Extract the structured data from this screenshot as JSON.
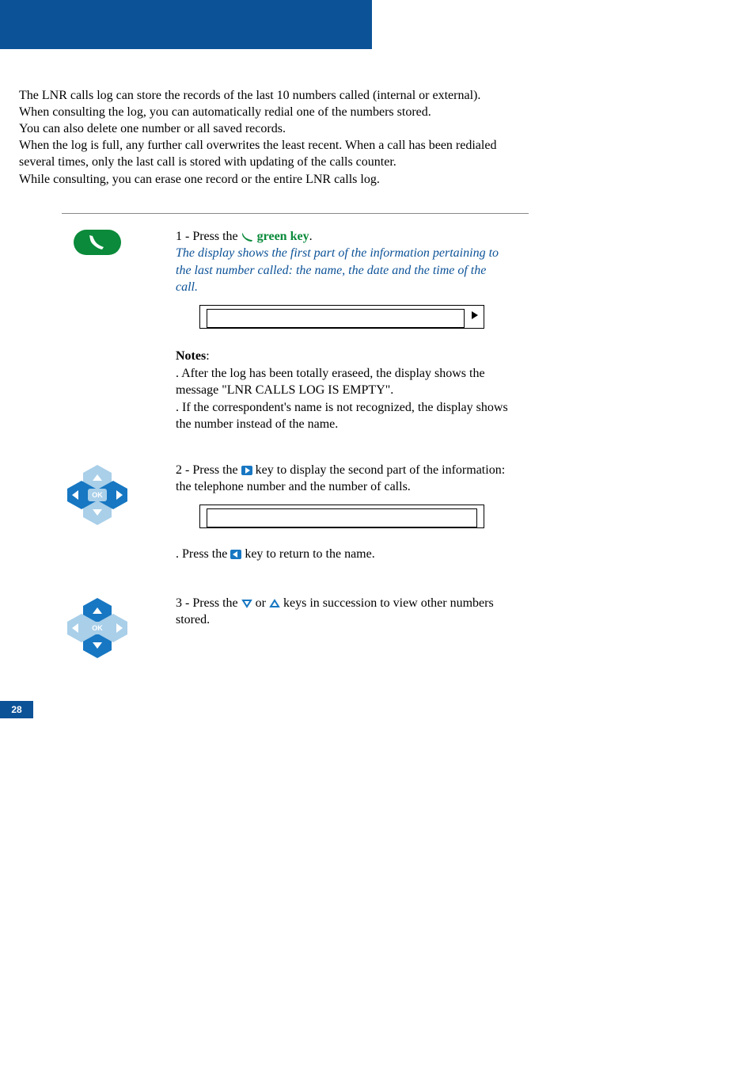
{
  "intro": {
    "l1": "The LNR calls log can store the records of the last 10 numbers called (internal or external).",
    "l2": "When consulting the log, you can automatically redial one of the numbers stored.",
    "l3": "You can also delete one number or all saved records.",
    "l4": "When the log is full, any further call overwrites the least recent. When a call has been redialed several times, only the last call is stored with updating of the calls counter.",
    "l5": "While consulting, you can erase one record or the entire LNR calls log."
  },
  "step1": {
    "prefix": "1 - Press the ",
    "greenkey": " green key",
    "suffix": ".",
    "desc": "The display shows the first part of the information pertaining to the last number called: the name, the date and the time of the call."
  },
  "notes": {
    "label": "Notes",
    "colon": ":",
    "n1": ". After the log has been totally eraseed, the display shows the message \"LNR CALLS LOG IS EMPTY\".",
    "n2": ". If the correspondent's name is not recognized, the display shows the number instead of the name."
  },
  "step2": {
    "prefix": "2 - Press the ",
    "mid": " key to display the second part of the information: the telephone number and the number of calls.",
    "ret_a": ". Press the ",
    "ret_b": " key to return to the name."
  },
  "step3": {
    "prefix": "3 - Press the ",
    "mid": " or ",
    "suffix": " keys in succession to view other numbers stored."
  },
  "pageNumber": "28",
  "navOK": "OK"
}
